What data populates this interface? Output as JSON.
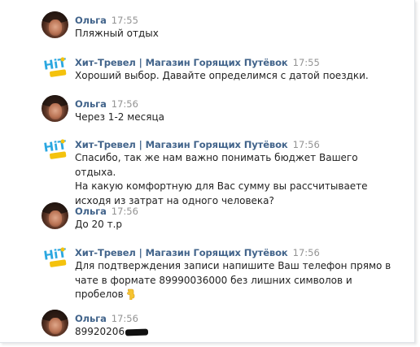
{
  "messages": [
    {
      "sender": "Ольга",
      "time": "17:55",
      "avatar": "user-photo",
      "lines": [
        "Пляжный отдых"
      ]
    },
    {
      "sender": "Хит-Тревел | Магазин Горящих Путёвок",
      "time": "17:55",
      "avatar": "hit-travel-logo",
      "lines": [
        "Хороший выбор. Давайте определимся с датой поездки."
      ]
    },
    {
      "sender": "Ольга",
      "time": "17:56",
      "avatar": "user-photo",
      "lines": [
        "Через 1-2 месяца"
      ]
    },
    {
      "sender": "Хит-Тревел | Магазин Горящих Путёвок",
      "time": "17:56",
      "avatar": "hit-travel-logo",
      "lines": [
        "Спасибо, так же нам важно понимать бюджет Вашего отдыха.",
        "На какую комфортную для Вас сумму вы рассчитываете",
        "исходя из затрат на одного человека?"
      ]
    },
    {
      "sender": "Ольга",
      "time": "17:56",
      "avatar": "user-photo",
      "lines": [
        "До 20 т.р"
      ]
    },
    {
      "sender": "Хит-Тревел | Магазин Горящих Путёвок",
      "time": "17:56",
      "avatar": "hit-travel-logo",
      "lines": [
        "Для подтверждения записи напишите Ваш телефон прямо в",
        "чате в формате 89990036000 без лишних символов и",
        "пробелов"
      ],
      "trailing_emoji": "pointing-down-hand-icon"
    },
    {
      "sender": "Ольга",
      "time": "17:56",
      "avatar": "user-photo",
      "lines": [
        "89920206"
      ],
      "redacted": true
    }
  ],
  "colors": {
    "sender_name": "#42648b",
    "time": "#939393",
    "text": "#222222",
    "logo_blue": "#2aa7e0",
    "logo_yellow": "#f4c20d"
  }
}
